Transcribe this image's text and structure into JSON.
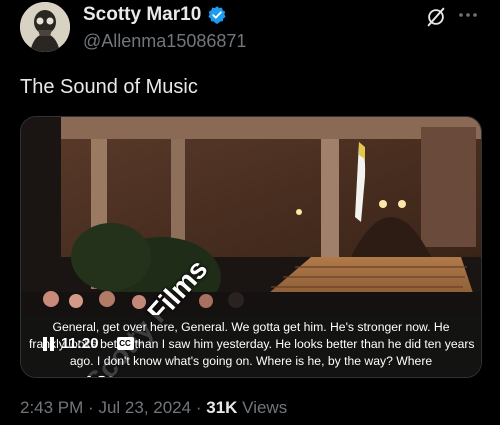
{
  "author": {
    "display_name": "Scotty Mar10",
    "handle": "@Allenma15086871",
    "verified": true
  },
  "tweet": {
    "text": "The Sound of Music"
  },
  "video": {
    "watermark": "Scotty Films",
    "time_remaining": "11:20",
    "cc_label": "CC",
    "captions": [
      "General, get over here, General. We gotta get him. He's stronger now. He",
      "frankly looks better than I saw him yesterday. He looks better than he did ten years",
      "ago. I don't know what's going on. Where is he, by the way? Where"
    ]
  },
  "meta": {
    "time": "2:43 PM",
    "separator": "·",
    "date": "Jul 23, 2024",
    "views_count": "31K",
    "views_label": "Views"
  },
  "icons": {
    "verified": "verified-badge-icon",
    "grok": "grok-icon",
    "more": "more-options-icon",
    "pause": "pause-icon",
    "cc": "closed-captions-icon"
  },
  "colors": {
    "background": "#000000",
    "text_primary": "#e7e9ea",
    "text_secondary": "#71767b",
    "verified_blue": "#1d9bf0"
  }
}
